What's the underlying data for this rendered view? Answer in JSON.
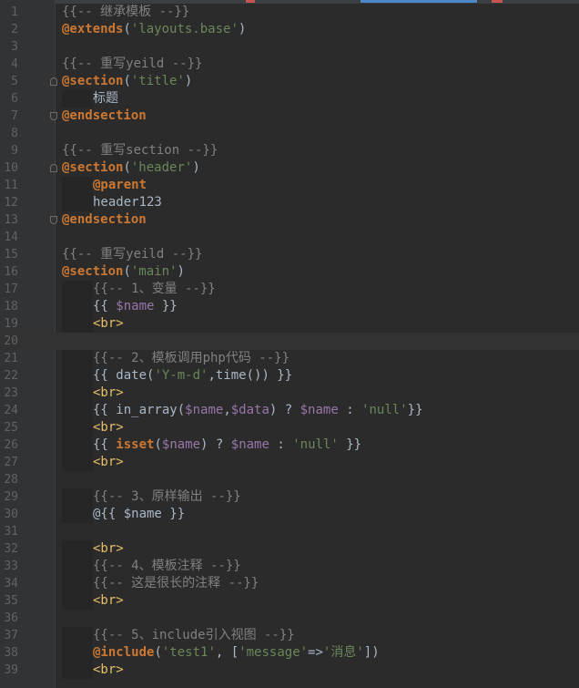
{
  "lines": [
    {
      "n": "1",
      "fold": "",
      "indent": false,
      "tokens": [
        {
          "t": "{{-- 继承模板 --}}",
          "c": "cm"
        }
      ]
    },
    {
      "n": "2",
      "fold": "",
      "indent": false,
      "tokens": [
        {
          "t": "@extends",
          "c": "dir"
        },
        {
          "t": "(",
          "c": "txt"
        },
        {
          "t": "'layouts.base'",
          "c": "str"
        },
        {
          "t": ")",
          "c": "txt"
        }
      ]
    },
    {
      "n": "3",
      "fold": "",
      "indent": false,
      "tokens": []
    },
    {
      "n": "4",
      "fold": "",
      "indent": false,
      "tokens": [
        {
          "t": "{{-- 重写yeild --}}",
          "c": "cm"
        }
      ]
    },
    {
      "n": "5",
      "fold": "start",
      "indent": false,
      "tokens": [
        {
          "t": "@section",
          "c": "dir"
        },
        {
          "t": "(",
          "c": "txt"
        },
        {
          "t": "'title'",
          "c": "str"
        },
        {
          "t": ")",
          "c": "txt"
        }
      ]
    },
    {
      "n": "6",
      "fold": "",
      "indent": true,
      "tokens": [
        {
          "t": "标题",
          "c": "txt"
        }
      ]
    },
    {
      "n": "7",
      "fold": "end",
      "indent": false,
      "tokens": [
        {
          "t": "@endsection",
          "c": "dir"
        }
      ]
    },
    {
      "n": "8",
      "fold": "",
      "indent": false,
      "tokens": []
    },
    {
      "n": "9",
      "fold": "",
      "indent": false,
      "tokens": [
        {
          "t": "{{-- 重写section --}}",
          "c": "cm"
        }
      ]
    },
    {
      "n": "10",
      "fold": "start",
      "indent": false,
      "tokens": [
        {
          "t": "@section",
          "c": "dir"
        },
        {
          "t": "(",
          "c": "txt"
        },
        {
          "t": "'header'",
          "c": "str"
        },
        {
          "t": ")",
          "c": "txt"
        }
      ]
    },
    {
      "n": "11",
      "fold": "",
      "indent": true,
      "tokens": [
        {
          "t": "@parent",
          "c": "dir"
        }
      ]
    },
    {
      "n": "12",
      "fold": "",
      "indent": true,
      "tokens": [
        {
          "t": "header123",
          "c": "txt"
        }
      ]
    },
    {
      "n": "13",
      "fold": "end",
      "indent": false,
      "tokens": [
        {
          "t": "@endsection",
          "c": "dir"
        }
      ]
    },
    {
      "n": "14",
      "fold": "",
      "indent": false,
      "tokens": []
    },
    {
      "n": "15",
      "fold": "",
      "indent": false,
      "tokens": [
        {
          "t": "{{-- 重写yeild --}}",
          "c": "cm"
        }
      ]
    },
    {
      "n": "16",
      "fold": "",
      "indent": false,
      "tokens": [
        {
          "t": "@section",
          "c": "dir"
        },
        {
          "t": "(",
          "c": "txt"
        },
        {
          "t": "'main'",
          "c": "str"
        },
        {
          "t": ")",
          "c": "txt"
        }
      ]
    },
    {
      "n": "17",
      "fold": "",
      "indent": true,
      "tokens": [
        {
          "t": "{{-- 1、变量 --}}",
          "c": "cm"
        }
      ]
    },
    {
      "n": "18",
      "fold": "",
      "indent": true,
      "tokens": [
        {
          "t": "{{ ",
          "c": "txt"
        },
        {
          "t": "$name",
          "c": "var"
        },
        {
          "t": " }}",
          "c": "txt"
        }
      ]
    },
    {
      "n": "19",
      "fold": "",
      "indent": true,
      "tokens": [
        {
          "t": "<br>",
          "c": "tag"
        }
      ]
    },
    {
      "n": "20",
      "fold": "",
      "indent": false,
      "current": true,
      "tokens": []
    },
    {
      "n": "21",
      "fold": "",
      "indent": true,
      "tokens": [
        {
          "t": "{{-- 2、模板调用php代码 --}}",
          "c": "cm"
        }
      ]
    },
    {
      "n": "22",
      "fold": "",
      "indent": true,
      "tokens": [
        {
          "t": "{{ date(",
          "c": "txt"
        },
        {
          "t": "'Y-m-d'",
          "c": "str"
        },
        {
          "t": ",time()) }}",
          "c": "txt"
        }
      ]
    },
    {
      "n": "23",
      "fold": "",
      "indent": true,
      "tokens": [
        {
          "t": "<br>",
          "c": "tag"
        }
      ]
    },
    {
      "n": "24",
      "fold": "",
      "indent": true,
      "tokens": [
        {
          "t": "{{ in_array(",
          "c": "txt"
        },
        {
          "t": "$name",
          "c": "var"
        },
        {
          "t": ",",
          "c": "txt"
        },
        {
          "t": "$data",
          "c": "var"
        },
        {
          "t": ") ? ",
          "c": "txt"
        },
        {
          "t": "$name",
          "c": "var"
        },
        {
          "t": " : ",
          "c": "txt"
        },
        {
          "t": "'null'",
          "c": "str"
        },
        {
          "t": "}}",
          "c": "txt"
        }
      ]
    },
    {
      "n": "25",
      "fold": "",
      "indent": true,
      "tokens": [
        {
          "t": "<br>",
          "c": "tag"
        }
      ]
    },
    {
      "n": "26",
      "fold": "",
      "indent": true,
      "tokens": [
        {
          "t": "{{ ",
          "c": "txt"
        },
        {
          "t": "isset",
          "c": "dir"
        },
        {
          "t": "(",
          "c": "txt"
        },
        {
          "t": "$name",
          "c": "var"
        },
        {
          "t": ") ? ",
          "c": "txt"
        },
        {
          "t": "$name",
          "c": "var"
        },
        {
          "t": " : ",
          "c": "txt"
        },
        {
          "t": "'null'",
          "c": "str"
        },
        {
          "t": " }}",
          "c": "txt"
        }
      ]
    },
    {
      "n": "27",
      "fold": "",
      "indent": true,
      "tokens": [
        {
          "t": "<br>",
          "c": "tag"
        }
      ]
    },
    {
      "n": "28",
      "fold": "",
      "indent": false,
      "tokens": []
    },
    {
      "n": "29",
      "fold": "",
      "indent": true,
      "tokens": [
        {
          "t": "{{-- 3、原样输出 --}}",
          "c": "cm"
        }
      ]
    },
    {
      "n": "30",
      "fold": "",
      "indent": true,
      "tokens": [
        {
          "t": "@{{ ",
          "c": "txt"
        },
        {
          "t": "$name",
          "c": "txt"
        },
        {
          "t": " }}",
          "c": "txt"
        }
      ]
    },
    {
      "n": "31",
      "fold": "",
      "indent": false,
      "tokens": []
    },
    {
      "n": "32",
      "fold": "",
      "indent": true,
      "tokens": [
        {
          "t": "<br>",
          "c": "tag"
        }
      ]
    },
    {
      "n": "33",
      "fold": "",
      "indent": true,
      "tokens": [
        {
          "t": "{{-- 4、模板注释 --}}",
          "c": "cm"
        }
      ]
    },
    {
      "n": "34",
      "fold": "",
      "indent": true,
      "tokens": [
        {
          "t": "{{-- 这是很长的注释 --}}",
          "c": "cm"
        }
      ]
    },
    {
      "n": "35",
      "fold": "",
      "indent": true,
      "tokens": [
        {
          "t": "<br>",
          "c": "tag"
        }
      ]
    },
    {
      "n": "36",
      "fold": "",
      "indent": false,
      "tokens": []
    },
    {
      "n": "37",
      "fold": "",
      "indent": true,
      "tokens": [
        {
          "t": "{{-- 5、include引入视图 --}}",
          "c": "cm"
        }
      ]
    },
    {
      "n": "38",
      "fold": "",
      "indent": true,
      "tokens": [
        {
          "t": "@include",
          "c": "dir"
        },
        {
          "t": "(",
          "c": "txt"
        },
        {
          "t": "'test1'",
          "c": "str"
        },
        {
          "t": ", [",
          "c": "txt"
        },
        {
          "t": "'message'",
          "c": "str"
        },
        {
          "t": "=>",
          "c": "txt"
        },
        {
          "t": "'消息'",
          "c": "str"
        },
        {
          "t": "])",
          "c": "txt"
        }
      ]
    },
    {
      "n": "39",
      "fold": "",
      "indent": true,
      "tokens": [
        {
          "t": "<br>",
          "c": "tag"
        }
      ]
    }
  ]
}
